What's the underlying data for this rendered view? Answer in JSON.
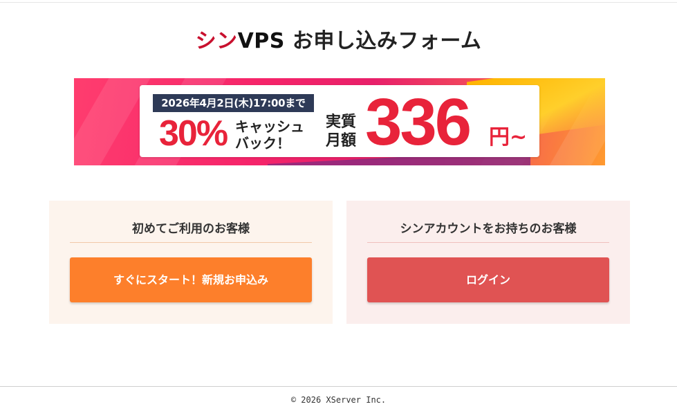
{
  "header": {
    "brand_shin": "シン",
    "brand_vps": "VPS",
    "title_rest": " お申し込みフォーム"
  },
  "banner": {
    "deadline": "2026年4月2日(木)17:00まで",
    "cashback_percent": "30%",
    "cashback_line1": "キャッシュ",
    "cashback_line2": "バック！",
    "monthly_line1": "実質",
    "monthly_line2": "月額",
    "price": "336",
    "price_unit": "円~",
    "colors": {
      "accent_red": "#e8233a",
      "deadline_bg": "#2e3a57"
    }
  },
  "panels": {
    "new_customer": {
      "heading": "初めてご利用のお客様",
      "button_label": "すぐにスタート！新規お申込み",
      "button_color": "#fd7f2b"
    },
    "existing_customer": {
      "heading": "シンアカウントをお持ちのお客様",
      "button_label": "ログイン",
      "button_color": "#e05353"
    }
  },
  "footer": {
    "copyright": "© 2026 XServer Inc."
  }
}
